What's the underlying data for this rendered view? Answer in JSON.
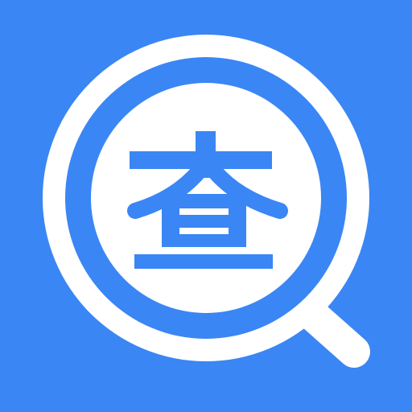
{
  "app_icon": {
    "glyph": "查",
    "icon_name": "magnifier-search-icon",
    "colors": {
      "background": "#3a86f4",
      "ring": "#ffffff",
      "glyph": "#3a86f4"
    }
  }
}
